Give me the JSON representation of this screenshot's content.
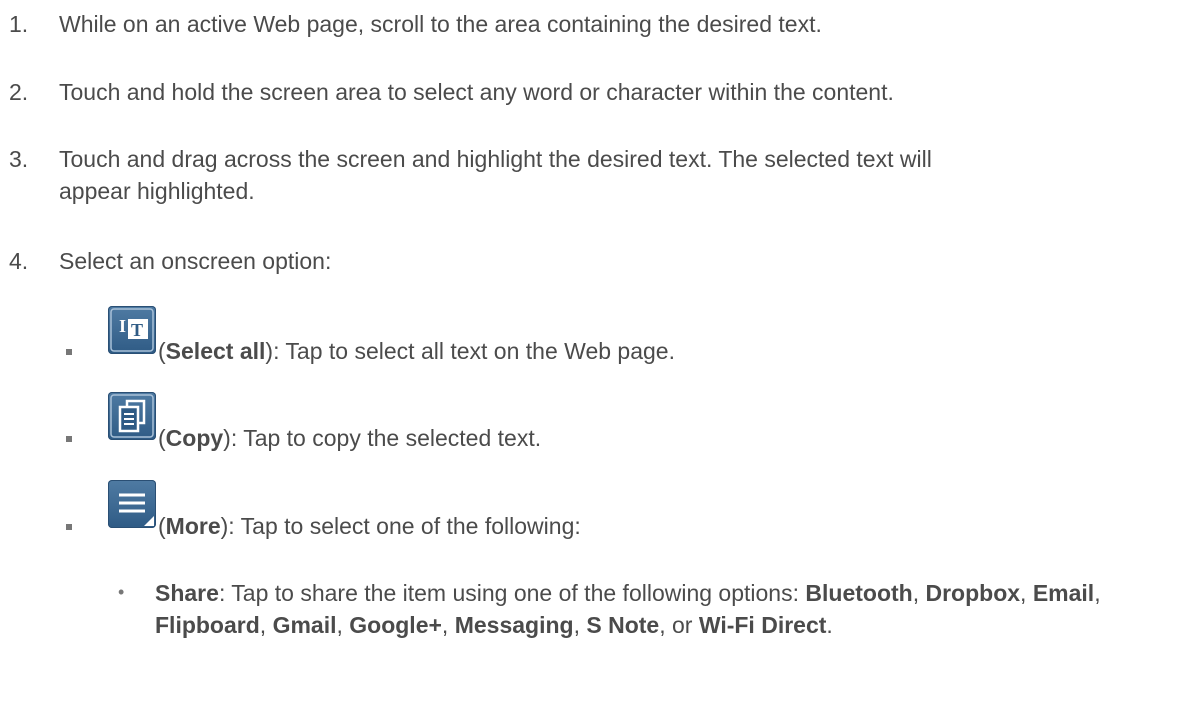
{
  "steps": [
    {
      "num": "1.",
      "text": "While on an active Web page, scroll to the area containing the desired text."
    },
    {
      "num": "2.",
      "text": "Touch and hold the screen area to select any word or character within the content."
    },
    {
      "num": "3.",
      "text_line1": "Touch and drag across the screen and highlight the desired text. The selected text will",
      "text_line2": "appear highlighted."
    },
    {
      "num": "4.",
      "text": "Select an onscreen option:"
    }
  ],
  "options": [
    {
      "icon": "select-all-icon",
      "open": "(",
      "name": "Select all",
      "desc": "): Tap to select all text on the Web page."
    },
    {
      "icon": "copy-icon",
      "open": "(",
      "name": "Copy",
      "desc": "): Tap to copy the selected text."
    },
    {
      "icon": "more-icon",
      "open": "(",
      "name": "More",
      "desc": "): Tap to select one of the following:"
    }
  ],
  "share": {
    "bullet": "•",
    "label": "Share",
    "intro": ": Tap to share the item using one of the following options: ",
    "items": [
      "Bluetooth",
      "Dropbox",
      "Email",
      "Flipboard",
      "Gmail",
      "Google+",
      "Messaging",
      "S Note",
      "Wi-Fi Direct"
    ],
    "sep": ", ",
    "or": "or ",
    "end": "."
  },
  "colors": {
    "text": "#4b4b4b",
    "icon_fill": "#3d6a94",
    "icon_glyph": "#ffffff"
  }
}
